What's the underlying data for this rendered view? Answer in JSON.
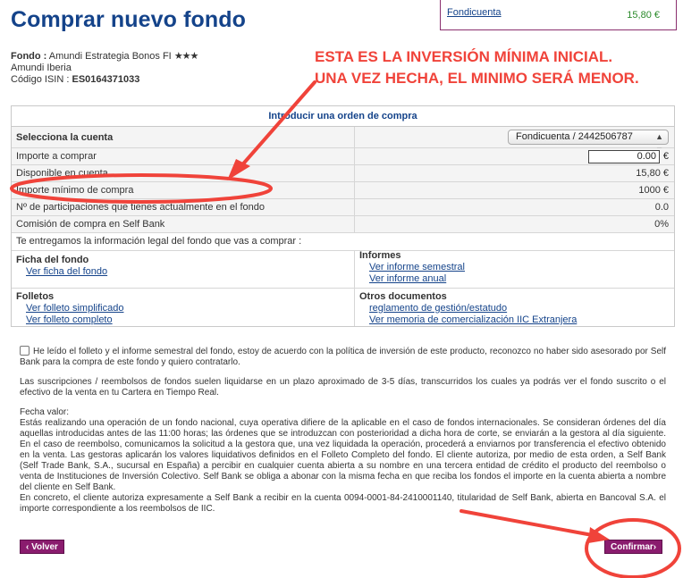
{
  "page": {
    "title": "Comprar nuevo fondo"
  },
  "side_box": {
    "fund_name": "Fondicuenta",
    "amount": "15,80 €"
  },
  "fund": {
    "label_fondo": "Fondo :",
    "name": "Amundi Estrategia Bonos FI",
    "stars": "★★★",
    "manager": "Amundi Iberia",
    "isin_label": "Código ISIN :",
    "isin": "ES0164371033"
  },
  "annotation": {
    "line1": "ESTA ES LA INVERSIÓN MÍNIMA INICIAL.",
    "line2": "UNA VEZ HECHA, EL MINIMO SERÁ MENOR."
  },
  "form": {
    "caption": "Introducir una orden de compra",
    "account_label": "Selecciona la cuenta",
    "account_value": "Fondicuenta / 2442506787",
    "amount_label": "Importe a comprar",
    "amount_value": "0.00",
    "currency": "€",
    "available_label": "Disponible en cuenta",
    "available_value": "15,80 €",
    "min_label": "Importe mínimo de compra",
    "min_value": "1000 €",
    "shares_label": "Nº de participaciones que tienes actualmente en el fondo",
    "shares_value": "0.0",
    "commission_label": "Comisión de compra en Self Bank",
    "commission_value": "0%",
    "legal_label": "Te entregamos la información legal del fondo que vas a comprar :"
  },
  "documents": {
    "ficha_title": "Ficha del fondo",
    "ficha_link": "Ver ficha del fondo",
    "informes_title": "Informes",
    "informe_semestral": "Ver informe semestral",
    "informe_anual": "Ver informe anual",
    "folletos_title": "Folletos",
    "folleto_simplificado": "Ver folleto simplificado",
    "folleto_completo": "Ver folleto completo",
    "otros_title": "Otros documentos",
    "reglamento": "reglamento de gestión/estatudo",
    "memoria": "Ver memoria de comercialización IIC Extranjera"
  },
  "terms": {
    "consent": "He leído el folleto y el informe semestral del fondo, estoy de acuerdo con la política de inversión de este producto, reconozco no haber sido asesorado por Self Bank para la compra de este fondo y quiero contratarlo.",
    "settlement": "Las suscripciones / reembolsos de fondos suelen liquidarse en un plazo aproximado de 3-5 días, transcurridos los cuales ya podrás ver el fondo suscrito o el efectivo de la venta en tu Cartera en Tiempo Real.",
    "value_date_title": "Fecha valor:",
    "value_date_body": "Estás realizando una operación de un fondo nacional, cuya operativa difiere de la aplicable en el caso de fondos internacionales. Se consideran órdenes del día aquellas introducidas antes de las 11:00 horas; las órdenes que se introduzcan con posterioridad a dicha hora de corte, se enviarán a la gestora al día siguiente. En el caso de reembolso, comunicamos la solicitud a la gestora que, una vez liquidada la operación, procederá a enviarnos por transferencia el efectivo obtenido en la venta. Las gestoras aplicarán los valores liquidativos definidos en el Folleto Completo del fondo. El cliente autoriza, por medio de esta orden, a Self Bank (Self Trade Bank, S.A., sucursal en España) a percibir en cualquier cuenta abierta a su nombre en una tercera entidad de crédito el producto del reembolso o venta de Instituciones de Inversión Colectivo. Self Bank se obliga a abonar con la misma fecha en que reciba los fondos el importe en la cuenta abierta a nombre del cliente en Self Bank.",
    "authorization": "En concreto, el cliente autoriza expresamente a Self Bank a recibir en la cuenta 0094-0001-84-2410001140, titularidad de Self Bank, abierta en Bancoval S.A. el importe correspondiente a los reembolsos de IIC."
  },
  "buttons": {
    "back": "‹ Volver",
    "confirm": "Confirmar›"
  },
  "colors": {
    "title_blue": "#14438a",
    "annotation_red": "#f0433a",
    "button_purple": "#8a1c6e"
  }
}
